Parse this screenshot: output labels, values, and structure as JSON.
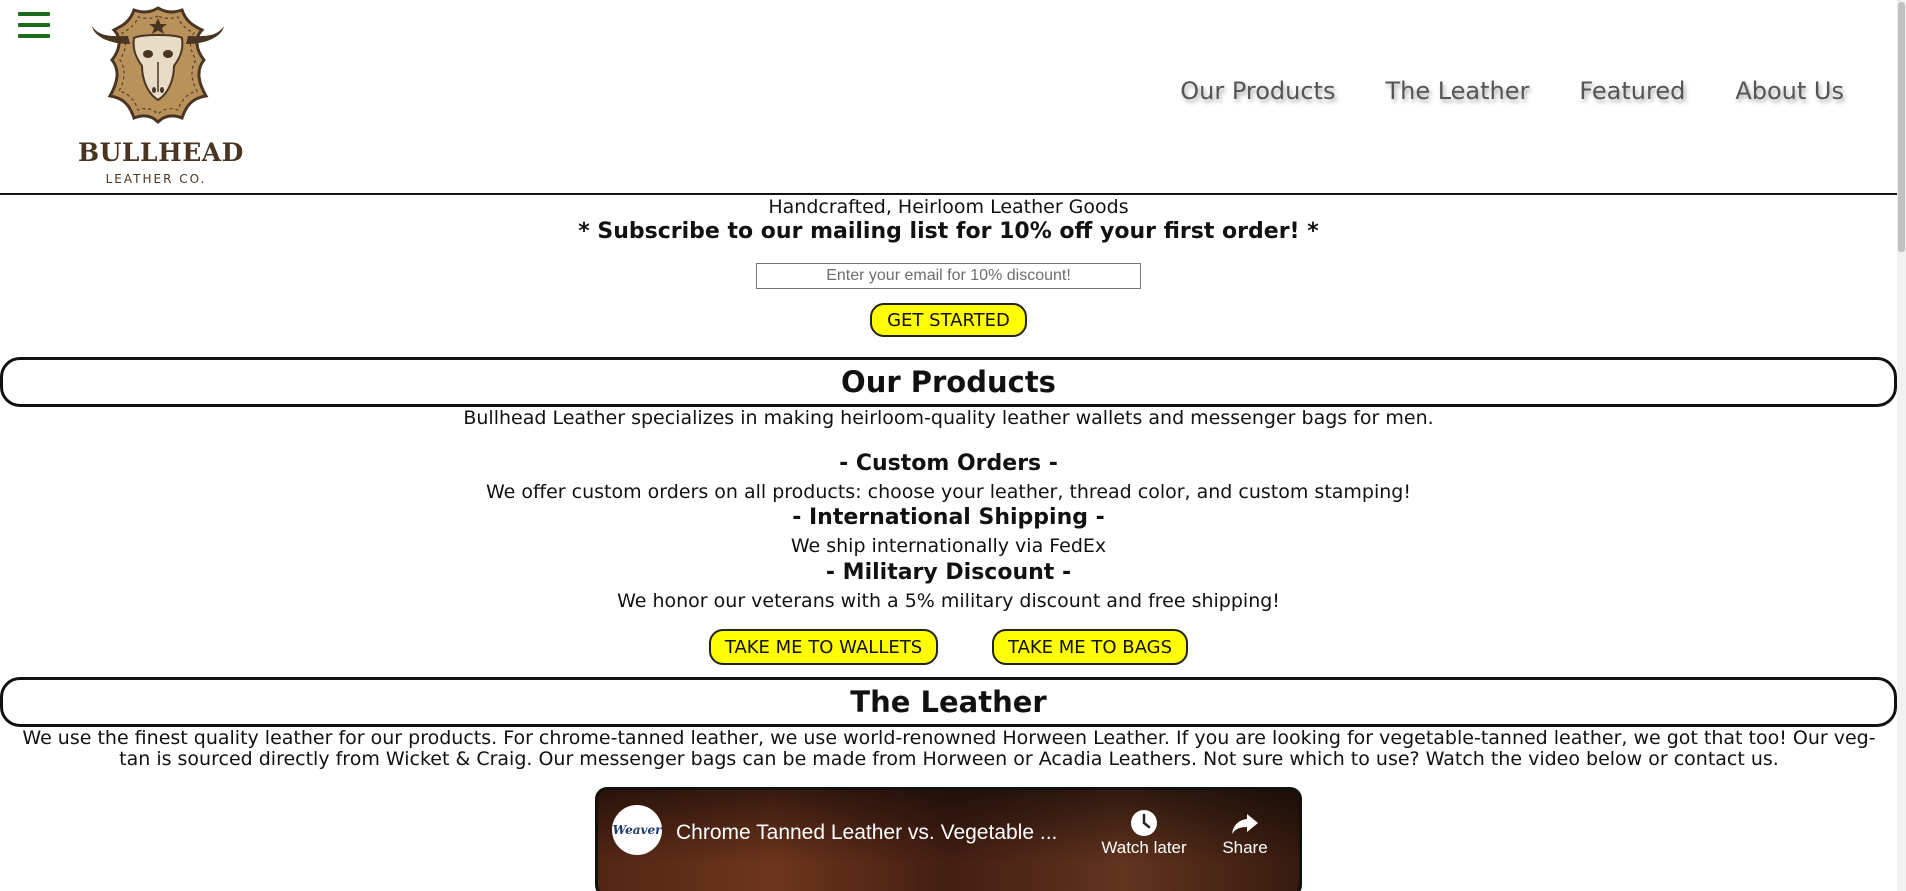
{
  "header": {
    "brand_name": "BULLHEAD",
    "brand_sub": "LEATHER CO.",
    "nav": [
      "Our Products",
      "The Leather",
      "Featured",
      "About Us"
    ]
  },
  "subscribe": {
    "tagline": "Handcrafted, Heirloom Leather Goods",
    "headline": "* Subscribe to our mailing list for 10% off your first order! *",
    "email_placeholder": "Enter your email for 10% discount!",
    "cta": "GET STARTED"
  },
  "products": {
    "heading": "Our Products",
    "intro": "Bullhead Leather specializes in making heirloom-quality leather wallets and messenger bags for men.",
    "features": [
      {
        "title": "- Custom Orders -",
        "text": "We offer custom orders on all products: choose your leather, thread color, and custom stamping!"
      },
      {
        "title": "- International Shipping -",
        "text": "We ship internationally via FedEx"
      },
      {
        "title": "- Military Discount -",
        "text": "We honor our veterans with a 5% military discount and free shipping!"
      }
    ],
    "buttons": [
      "TAKE ME TO WALLETS",
      "TAKE ME TO BAGS"
    ]
  },
  "leather": {
    "heading": "The Leather",
    "text": "We use the finest quality leather for our products. For chrome-tanned leather, we use world-renowned Horween Leather. If you are looking for vegetable-tanned leather, we got that too! Our veg-tan is sourced directly from Wicket & Craig. Our messenger bags can be made from Horween or Acadia Leathers. Not sure which to use? Watch the video below or contact us."
  },
  "video": {
    "channel_logo_text": "Weaver",
    "title": "Chrome Tanned Leather vs. Vegetable ...",
    "watch_later": "Watch later",
    "share": "Share"
  },
  "colors": {
    "accent_button": "#ffff00",
    "hamburger": "#1b6b1b",
    "brand": "#4a3523"
  }
}
